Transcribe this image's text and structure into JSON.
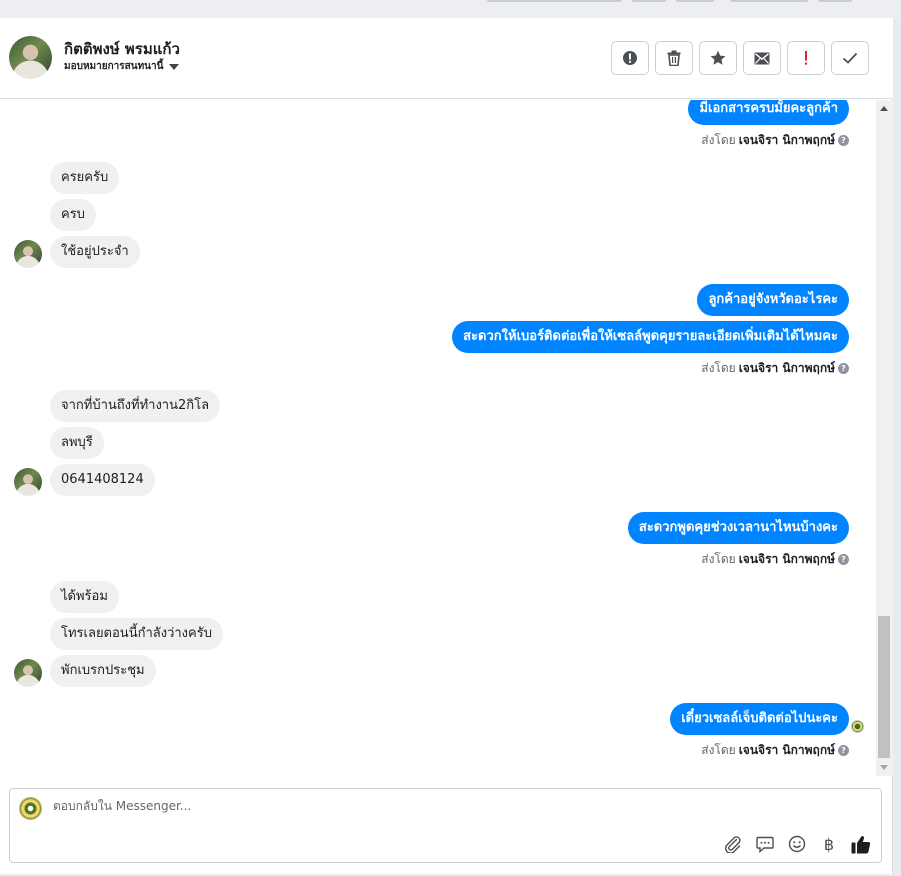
{
  "header": {
    "contact_name": "กิตติพงษ์ พรมแก้ว",
    "assign_label": "มอบหมายการสนทนานี้",
    "actions": [
      {
        "icon": "alert-circle-icon",
        "name": "mark-spam-button"
      },
      {
        "icon": "trash-icon",
        "name": "delete-button"
      },
      {
        "icon": "star-icon",
        "name": "star-button"
      },
      {
        "icon": "envelope-icon",
        "name": "mark-unread-button"
      },
      {
        "icon": "exclamation-icon",
        "name": "follow-up-button"
      },
      {
        "icon": "check-icon",
        "name": "mark-done-button"
      }
    ]
  },
  "thread": {
    "sent_by_prefix": "ส่งโดย",
    "sent_by_name": "เจนจิรา นิกาพฤกษ์",
    "messages": [
      {
        "dir": "out",
        "text": "มีเอกสารครบมั้ยคะลูกค้า"
      },
      {
        "dir": "in",
        "text": "ครยครับ"
      },
      {
        "dir": "in",
        "text": "ครบ"
      },
      {
        "dir": "in",
        "text": "ใช้อยู่ประจำ"
      },
      {
        "dir": "out",
        "text": "ลูกค้าอยู่จังหวัดอะไรคะ"
      },
      {
        "dir": "out",
        "text": "สะดวกให้เบอร์ติดต่อเพื่อให้เซลล์พูดคุยรายละเอียดเพิ่มเติมได้ไหมคะ"
      },
      {
        "dir": "in",
        "text": "จากที่บ้านถึงที่ทำงาน2กิโล"
      },
      {
        "dir": "in",
        "text": "ลพบุรี"
      },
      {
        "dir": "in",
        "text": "0641408124"
      },
      {
        "dir": "out",
        "text": "สะดวกพูดคุยช่วงเวลานาไหนบ้างคะ"
      },
      {
        "dir": "in",
        "text": "ได้พร้อม"
      },
      {
        "dir": "in",
        "text": "โทรเลยตอนนี้กำลังว่างครับ"
      },
      {
        "dir": "in",
        "text": "พักเบรกประชุม"
      },
      {
        "dir": "out",
        "text": "เดี๋ยวเซลล์เจ็บติดต่อไปนะคะ"
      }
    ]
  },
  "composer": {
    "placeholder": "ตอบกลับใน Messenger...",
    "value": "",
    "currency_symbol": "฿"
  },
  "colors": {
    "outgoing_bubble": "#0084ff",
    "incoming_bubble": "#f0f0f0"
  }
}
